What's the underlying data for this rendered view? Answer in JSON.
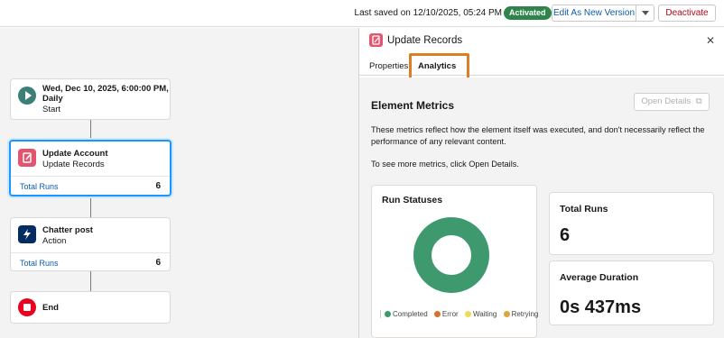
{
  "toolbar": {
    "saved_text": "Last saved on 12/10/2025, 05:24 PM",
    "status_badge": "Activated",
    "edit_button": "Edit As New Version",
    "deactivate_button": "Deactivate"
  },
  "canvas": {
    "nodes": [
      {
        "title": "Wed, Dec 10, 2025, 6:00:00 PM, Daily",
        "subtitle": "Start",
        "icon": "play-icon",
        "color": "#3b7f76"
      },
      {
        "title": "Update Account",
        "subtitle": "Update Records",
        "icon": "update-records-icon",
        "color": "#e3546f",
        "footer_label": "Total Runs",
        "footer_value": "6"
      },
      {
        "title": "Chatter post",
        "subtitle": "Action",
        "icon": "lightning-icon",
        "color": "#032d60",
        "footer_label": "Total Runs",
        "footer_value": "6"
      },
      {
        "title": "End",
        "icon": "stop-icon",
        "color": "#ea001e"
      }
    ]
  },
  "panel": {
    "title": "Update Records",
    "icon": "update-records-icon",
    "tabs": [
      {
        "label": "Properties"
      },
      {
        "label": "Analytics"
      }
    ],
    "section_title": "Element Metrics",
    "open_details": "Open Details",
    "description": "These metrics reflect how the element itself was executed, and don't necessarily reflect the performance of any relevant content.",
    "more_metrics": "To see more metrics, click Open Details.",
    "run_statuses": {
      "title": "Run Statuses",
      "legend": [
        {
          "label": "Completed",
          "color": "#3e9a6e"
        },
        {
          "label": "Error",
          "color": "#d3732c"
        },
        {
          "label": "Waiting",
          "color": "#e9dd5a"
        },
        {
          "label": "Retrying",
          "color": "#e0a43c"
        }
      ]
    },
    "total_runs": {
      "label": "Total Runs",
      "value": "6"
    },
    "average_duration": {
      "label": "Average Duration",
      "value": "0s 437ms"
    }
  }
}
